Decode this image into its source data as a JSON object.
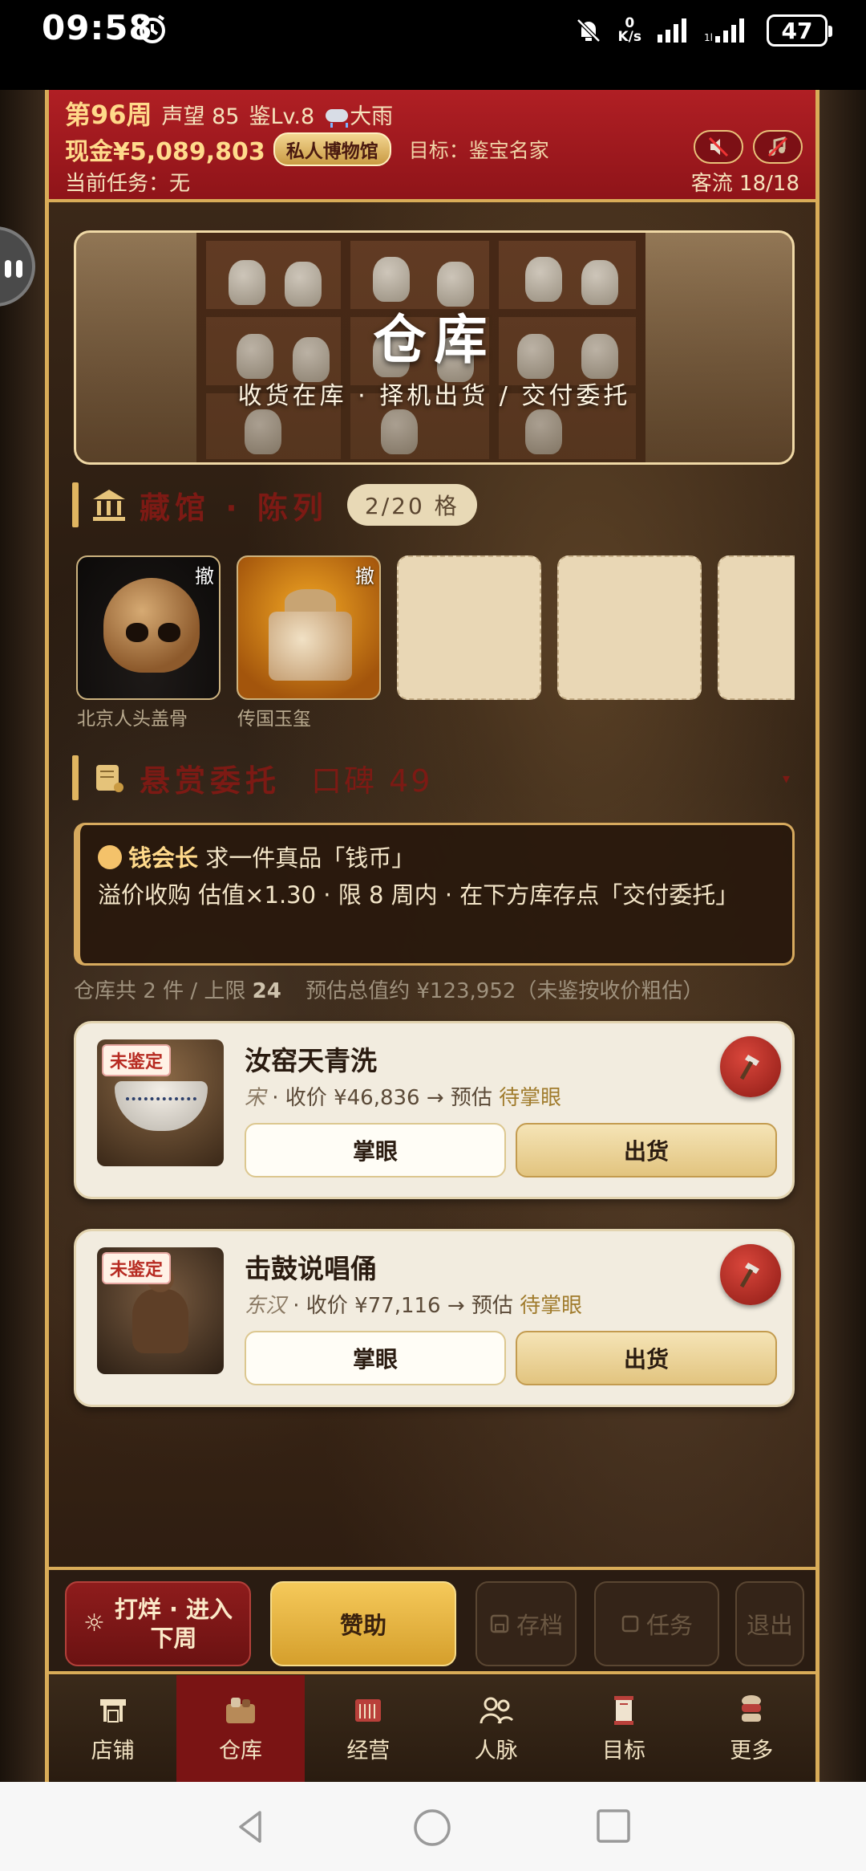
{
  "status_bar": {
    "time": "09:58",
    "speed_value": "0",
    "speed_unit": "K/s",
    "battery": "47"
  },
  "header": {
    "week": "第96周",
    "reputation": "声望 85",
    "appraisal_level": "鉴Lv.8",
    "weather": "大雨",
    "cash": "现金¥5,089,803",
    "museum_badge": "私人博物馆",
    "goal": "目标：鉴宝名家",
    "task": "当前任务：无",
    "guests": "客流 18/18"
  },
  "banner": {
    "title": "仓库",
    "subtitle": "收货在库 · 择机出货 / 交付委托"
  },
  "display": {
    "title": "藏馆 · 陈列",
    "slot_count": "2/20 格",
    "slots": [
      {
        "label": "北京人头盖骨",
        "withdraw": "撤"
      },
      {
        "label": "传国玉玺",
        "withdraw": "撤"
      }
    ]
  },
  "bounty": {
    "title": "悬赏委托",
    "reputation": "口碑 49",
    "client": "钱会长",
    "request": "求一件真品「钱币」",
    "detail": "溢价收购 估值×1.30 · 限 8 周内 · 在下方库存点「交付委托」"
  },
  "summary": {
    "prefix": "仓库共 2 件 / 上限 ",
    "limit": "24",
    "value_text": "预估总值约 ¥123,952（未鉴按收价粗估）"
  },
  "items": [
    {
      "badge": "未鉴定",
      "name": "汝窑天青洗",
      "era": "宋",
      "price_text": " · 收价 ¥46,836 → 预估 ",
      "pending": "待掌眼",
      "look": "掌眼",
      "sell": "出货"
    },
    {
      "badge": "未鉴定",
      "name": "击鼓说唱俑",
      "era": "东汉",
      "price_text": " · 收价 ¥77,116 → 预估 ",
      "pending": "待掌眼",
      "look": "掌眼",
      "sell": "出货"
    }
  ],
  "actions": {
    "next_week_line1": "打烊 · 进入",
    "next_week_line2": "下周",
    "sponsor": "赞助",
    "save": "存档",
    "task": "任务",
    "exit": "退出"
  },
  "nav": [
    {
      "label": "店铺",
      "icon": "shop-icon"
    },
    {
      "label": "仓库",
      "icon": "warehouse-icon",
      "active": true
    },
    {
      "label": "经营",
      "icon": "ledger-icon"
    },
    {
      "label": "人脉",
      "icon": "people-icon"
    },
    {
      "label": "目标",
      "icon": "scroll-icon"
    },
    {
      "label": "更多",
      "icon": "more-icon"
    }
  ],
  "colors": {
    "accent_red": "#9b1a1f",
    "gold": "#d9ac58",
    "card_bg": "#f2ecdf"
  }
}
